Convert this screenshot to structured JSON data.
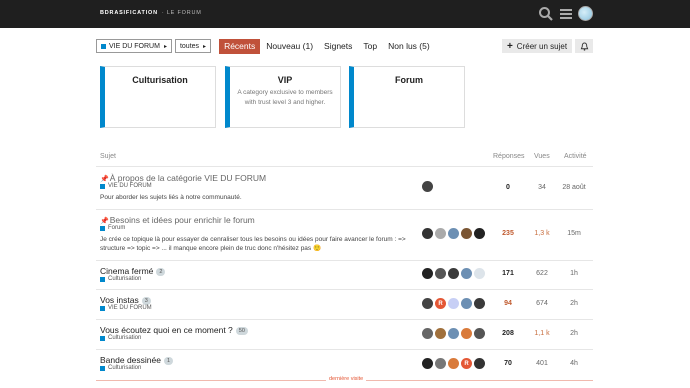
{
  "header": {
    "logo": "BDRASIFICATION",
    "logo_sub": "· LE FORUM"
  },
  "nav": {
    "category": "VIE DU FORUM",
    "tag": "toutes",
    "tabs": [
      "Récents",
      "Nouveau (1)",
      "Signets",
      "Top",
      "Non lus (5)"
    ],
    "create": "Créer un sujet"
  },
  "cats": [
    {
      "title": "Culturisation",
      "desc": ""
    },
    {
      "title": "VIP",
      "desc": "A category exclusive to members with trust level 3 and higher."
    },
    {
      "title": "Forum",
      "desc": ""
    }
  ],
  "cols": {
    "topic": "Sujet",
    "replies": "Réponses",
    "views": "Vues",
    "activity": "Activité"
  },
  "topics": [
    {
      "title": "À propos de la catégorie VIE DU FORUM",
      "category": "VIE DU FORUM",
      "excerpt": "Pour aborder les sujets liés à notre communauté.",
      "replies": "0",
      "views": "34",
      "activity": "28 août"
    },
    {
      "title": "Besoins et idées pour enrichir le forum",
      "category": "Forum",
      "excerpt": "Je crée ce topique là pour essayer de cenraliser tous les besoins ou idées pour faire avancer le forum : => structure => topic => ... il manque encore plein de truc donc n'hésitez pas",
      "replies": "235",
      "views": "1,3 k",
      "activity": "15m"
    },
    {
      "title": "Cinema fermé",
      "count": "2",
      "category": "Culturisation",
      "replies": "171",
      "views": "622",
      "activity": "1h"
    },
    {
      "title": "Vos instas",
      "count": "3",
      "category": "VIE DU FORUM",
      "replies": "94",
      "views": "674",
      "activity": "2h"
    },
    {
      "title": "Vous écoutez quoi en ce moment ?",
      "count": "50",
      "category": "Culturisation",
      "replies": "208",
      "views": "1,1 k",
      "activity": "2h"
    },
    {
      "title": "Bande dessinée",
      "count": "1",
      "category": "Culturisation",
      "replies": "70",
      "views": "401",
      "activity": "4h"
    }
  ],
  "avatars": [
    "M",
    "R",
    "R"
  ],
  "last_visit": "dernière visite"
}
